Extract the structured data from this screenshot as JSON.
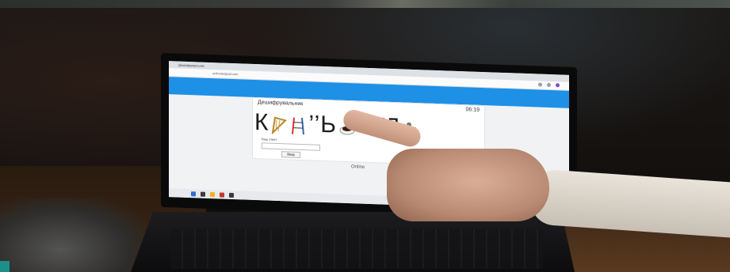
{
  "photo": {
    "subject": "laptop-screen-with-pointing-hand",
    "screen": {
      "browser_tab_label": "Дешифрувальник",
      "address_text": "onlinetestpad.com",
      "card_title": "Дешифрувальник",
      "timer": "06:19",
      "puzzle_text": [
        "К",
        "’’Ь",
        "’’УД"
      ],
      "answer_label": "Ваш ответ:",
      "check_button": "Ввод",
      "footer_logo": "Online"
    },
    "colors": {
      "accent_blue": "#1e90e6",
      "room_dark": "#0d0b0a"
    }
  }
}
